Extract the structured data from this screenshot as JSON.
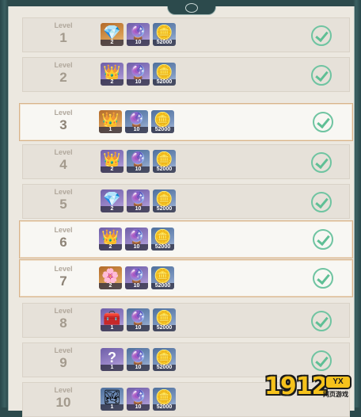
{
  "level_label": "Level",
  "rows": [
    {
      "level": "1",
      "highlighted": false,
      "claimed": true,
      "items": [
        {
          "icon": "blue-gem-icon",
          "quantity": "2",
          "color": "orange"
        },
        {
          "icon": "purple-crystal-icon",
          "quantity": "10",
          "color": "purple"
        },
        {
          "icon": "gold-coin-icon",
          "quantity": "52000",
          "color": "blue"
        }
      ]
    },
    {
      "level": "2",
      "highlighted": false,
      "claimed": true,
      "items": [
        {
          "icon": "gold-crown-icon",
          "quantity": "2",
          "color": "purple"
        },
        {
          "icon": "purple-crystal-icon",
          "quantity": "10",
          "color": "purple"
        },
        {
          "icon": "gold-coin-icon",
          "quantity": "52000",
          "color": "blue"
        }
      ]
    },
    {
      "level": "3",
      "highlighted": true,
      "claimed": true,
      "items": [
        {
          "icon": "gold-crown-icon",
          "quantity": "1",
          "color": "orange"
        },
        {
          "icon": "purple-crystal-icon",
          "quantity": "10",
          "color": "blue"
        },
        {
          "icon": "gold-coin-icon",
          "quantity": "52000",
          "color": "blue"
        }
      ]
    },
    {
      "level": "4",
      "highlighted": false,
      "claimed": true,
      "items": [
        {
          "icon": "gold-crown-icon",
          "quantity": "2",
          "color": "purple"
        },
        {
          "icon": "purple-crystal-icon",
          "quantity": "10",
          "color": "blue"
        },
        {
          "icon": "gold-coin-icon",
          "quantity": "52000",
          "color": "blue"
        }
      ]
    },
    {
      "level": "5",
      "highlighted": false,
      "claimed": true,
      "items": [
        {
          "icon": "blue-gem-icon",
          "quantity": "2",
          "color": "purple"
        },
        {
          "icon": "purple-crystal-icon",
          "quantity": "10",
          "color": "purple"
        },
        {
          "icon": "gold-coin-icon",
          "quantity": "52000",
          "color": "blue"
        }
      ]
    },
    {
      "level": "6",
      "highlighted": true,
      "claimed": true,
      "items": [
        {
          "icon": "gold-crown-icon",
          "quantity": "2",
          "color": "purple"
        },
        {
          "icon": "purple-crystal-icon",
          "quantity": "10",
          "color": "purple"
        },
        {
          "icon": "gold-coin-icon",
          "quantity": "52000",
          "color": "blue"
        }
      ]
    },
    {
      "level": "7",
      "highlighted": true,
      "claimed": true,
      "items": [
        {
          "icon": "pink-orb-icon",
          "quantity": "2",
          "color": "orange"
        },
        {
          "icon": "purple-crystal-icon",
          "quantity": "10",
          "color": "purple"
        },
        {
          "icon": "gold-coin-icon",
          "quantity": "52000",
          "color": "blue"
        }
      ]
    },
    {
      "level": "8",
      "highlighted": false,
      "claimed": true,
      "items": [
        {
          "icon": "silver-chest-icon",
          "quantity": "1",
          "color": "purple"
        },
        {
          "icon": "purple-crystal-icon",
          "quantity": "10",
          "color": "blue"
        },
        {
          "icon": "gold-coin-icon",
          "quantity": "52000",
          "color": "blue"
        }
      ]
    },
    {
      "level": "9",
      "highlighted": false,
      "claimed": true,
      "items": [
        {
          "icon": "question-mark-icon",
          "quantity": "1",
          "color": "purple"
        },
        {
          "icon": "purple-crystal-icon",
          "quantity": "10",
          "color": "blue"
        },
        {
          "icon": "gold-coin-icon",
          "quantity": "52000",
          "color": "blue"
        }
      ]
    },
    {
      "level": "10",
      "highlighted": false,
      "claimed": false,
      "items": [
        {
          "icon": "scenery-icon",
          "quantity": "1",
          "color": "blue"
        },
        {
          "icon": "purple-crystal-icon",
          "quantity": "10",
          "color": "purple"
        },
        {
          "icon": "gold-coin-icon",
          "quantity": "52000",
          "color": "blue"
        }
      ]
    }
  ],
  "watermark": {
    "number": "1912",
    "badge": "YX",
    "subtitle": "网页游戏"
  },
  "colors": {
    "check": "#5fbf95",
    "frame": "#2c4a4c",
    "highlight_border": "#d8b38a"
  }
}
